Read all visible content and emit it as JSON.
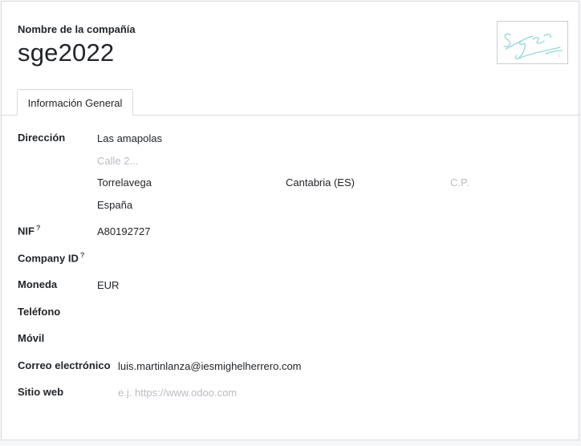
{
  "header": {
    "company_label": "Nombre de la compañía",
    "company_name": "sge2022",
    "logo_text": "Sge"
  },
  "tabs": [
    {
      "label": "Información General"
    }
  ],
  "fields": {
    "address": {
      "label": "Dirección",
      "street": "Las amapolas",
      "street2_placeholder": "Calle 2...",
      "city": "Torrelavega",
      "state": "Cantabria (ES)",
      "zip_placeholder": "C.P.",
      "country": "España"
    },
    "vat": {
      "label": "NIF",
      "help": "?",
      "value": "A80192727"
    },
    "company_id": {
      "label": "Company ID",
      "help": "?",
      "value": ""
    },
    "currency": {
      "label": "Moneda",
      "value": "EUR"
    },
    "phone": {
      "label": "Teléfono",
      "value": ""
    },
    "mobile": {
      "label": "Móvil",
      "value": ""
    },
    "email": {
      "label": "Correo electrónico",
      "value": "luis.martinlanza@iesmighelherrero.com"
    },
    "website": {
      "label": "Sitio web",
      "placeholder": "e.j. https://www.odoo.com"
    }
  }
}
